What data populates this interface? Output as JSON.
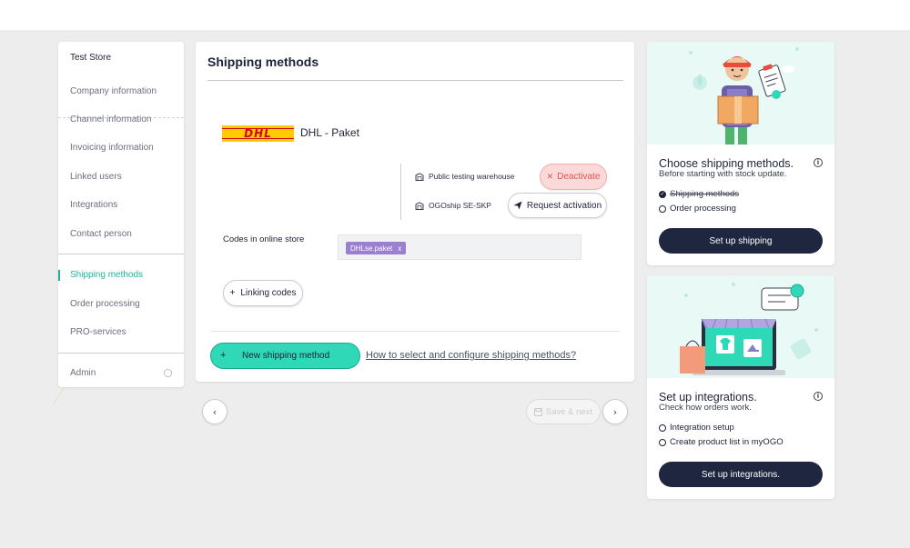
{
  "sidebar": {
    "store_name": "Test Store",
    "items": [
      {
        "label": "Company information"
      },
      {
        "label": "Channel information"
      },
      {
        "label": "Invoicing information"
      },
      {
        "label": "Linked users"
      },
      {
        "label": "Integrations"
      },
      {
        "label": "Contact person"
      },
      {
        "label": "Shipping methods",
        "active": true
      },
      {
        "label": "Order processing"
      },
      {
        "label": "PRO-services"
      }
    ],
    "admin_label": "Admin"
  },
  "main": {
    "title": "Shipping methods",
    "carrier": {
      "logo_text": "DHL",
      "name": "DHL - Paket",
      "warehouses": [
        {
          "name": "Public testing warehouse",
          "action": "Deactivate"
        },
        {
          "name": "OGOship SE-SKP",
          "action": "Request activation"
        }
      ],
      "codes_label": "Codes in online store",
      "codes": [
        {
          "code": "DHLse.paket",
          "remove": "x"
        }
      ],
      "linking_codes_label": "Linking codes",
      "linking_codes_icon": "+"
    },
    "new_method_icon": "+",
    "new_method_label": "New shipping method",
    "howto_link": "How to select and configure shipping methods?"
  },
  "pager": {
    "prev_icon": "‹",
    "save_next_label": "Save & next",
    "next_icon": "›"
  },
  "cards": [
    {
      "title": "Choose shipping methods.",
      "subtitle": "Before starting with stock update.",
      "steps": [
        {
          "label": "Shipping methods",
          "done": true
        },
        {
          "label": "Order processing",
          "done": false
        }
      ],
      "button": "Set up shipping"
    },
    {
      "title": "Set up integrations.",
      "subtitle": "Check how orders work.",
      "steps": [
        {
          "label": "Integration setup",
          "done": false
        },
        {
          "label": "Create product list in myOGO",
          "done": false
        }
      ],
      "button": "Set up integrations."
    }
  ],
  "colors": {
    "accent": "#2fd9b8",
    "active_nav": "#1eb49a",
    "dark_button": "#1f2740",
    "danger": "#e05555",
    "chip": "#9b7fd0",
    "dhl_yellow": "#ffcc00",
    "dhl_red": "#d40511"
  },
  "icons": {
    "warehouse": "warehouse-icon",
    "deactivate": "x-icon",
    "request": "send-icon",
    "save": "floppy-icon",
    "info": "info-icon",
    "check": "check-circle-icon"
  }
}
